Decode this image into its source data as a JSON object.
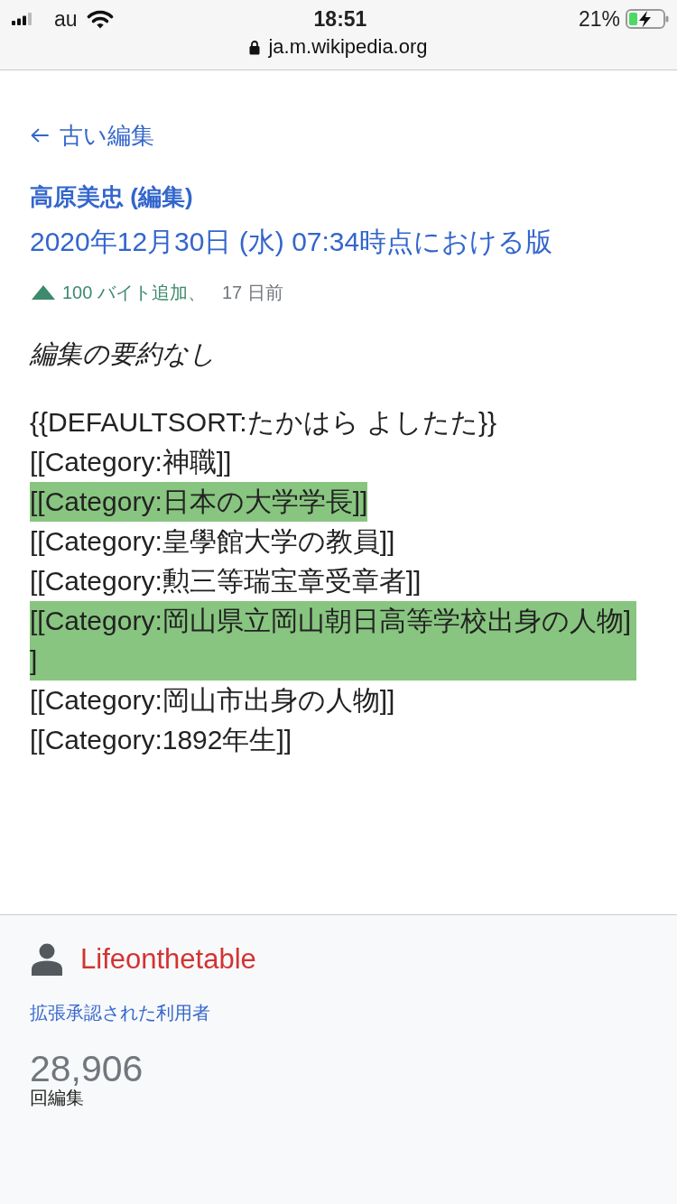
{
  "status_bar": {
    "carrier": "au",
    "time": "18:51",
    "battery": "21%"
  },
  "address_bar": {
    "url": "ja.m.wikipedia.org"
  },
  "page": {
    "back_link": "古い編集",
    "revision": {
      "title": "高原美忠 (編集)",
      "timestamp": "2020年12月30日 (水) 07:34時点における版",
      "size_change": "100 バイト追加、",
      "age": "17 日前"
    },
    "summary": "編集の要約なし"
  },
  "diff": {
    "lines": [
      {
        "text": "{{DEFAULTSORT:たかはら よしたた}}",
        "added": false
      },
      {
        "text": "[[Category:神職]]",
        "added": false
      },
      {
        "text": "[[Category:日本の大学学長]]",
        "added": true
      },
      {
        "text": "[[Category:皇學館大学の教員]]",
        "added": false
      },
      {
        "text": "[[Category:勲三等瑞宝章受章者]]",
        "added": false
      },
      {
        "text": "[[Category:岡山県立岡山朝日高等学校出身の人物]]",
        "added": true
      },
      {
        "text": "[[Category:岡山市出身の人物]]",
        "added": false
      },
      {
        "text": "[[Category:1892年生]]",
        "added": false
      }
    ]
  },
  "user": {
    "name": "Lifeonthetable",
    "group": "拡張承認された利用者",
    "edit_count": "28,906",
    "edit_count_label": "回編集"
  }
}
